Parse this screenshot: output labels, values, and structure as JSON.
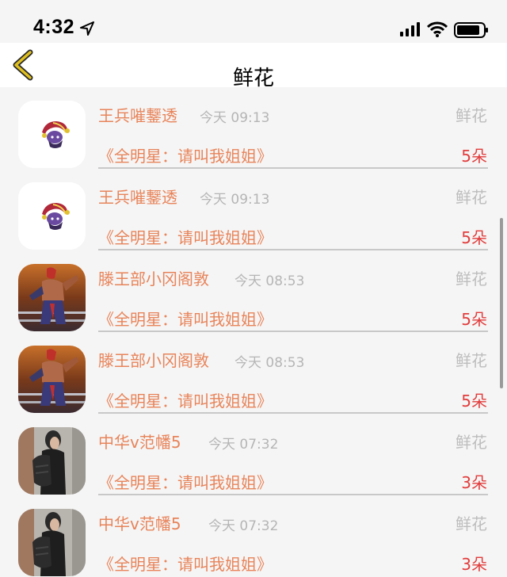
{
  "status_bar": {
    "time": "4:32"
  },
  "nav": {
    "title": "鲜花"
  },
  "records": [
    {
      "name": "王兵嗺鑋透",
      "time": "今天 09:13",
      "gift": "鲜花",
      "title": "《全明星：请叫我姐姐》",
      "count": "5朵",
      "avatar": "avatar-jester-icon"
    },
    {
      "name": "王兵嗺鑋透",
      "time": "今天 09:13",
      "gift": "鲜花",
      "title": "《全明星：请叫我姐姐》",
      "count": "5朵",
      "avatar": "avatar-jester-icon"
    },
    {
      "name": "滕王部小冈阁敦",
      "time": "今天 08:53",
      "gift": "鲜花",
      "title": "《全明星：请叫我姐姐》",
      "count": "5朵",
      "avatar": "avatar-fighter-icon"
    },
    {
      "name": "滕王部小冈阁敦",
      "time": "今天 08:53",
      "gift": "鲜花",
      "title": "《全明星：请叫我姐姐》",
      "count": "5朵",
      "avatar": "avatar-fighter-icon"
    },
    {
      "name": "中华v范幡5",
      "time": "今天 07:32",
      "gift": "鲜花",
      "title": "《全明星：请叫我姐姐》",
      "count": "3朵",
      "avatar": "avatar-person-icon"
    },
    {
      "name": "中华v范幡5",
      "time": "今天 07:32",
      "gift": "鲜花",
      "title": "《全明星：请叫我姐姐》",
      "count": "3朵",
      "avatar": "avatar-person-icon"
    }
  ],
  "colors": {
    "name": "#e8845a",
    "count": "#e23c3c",
    "muted": "#b5b5b5",
    "back_arrow": "#e0c020"
  }
}
